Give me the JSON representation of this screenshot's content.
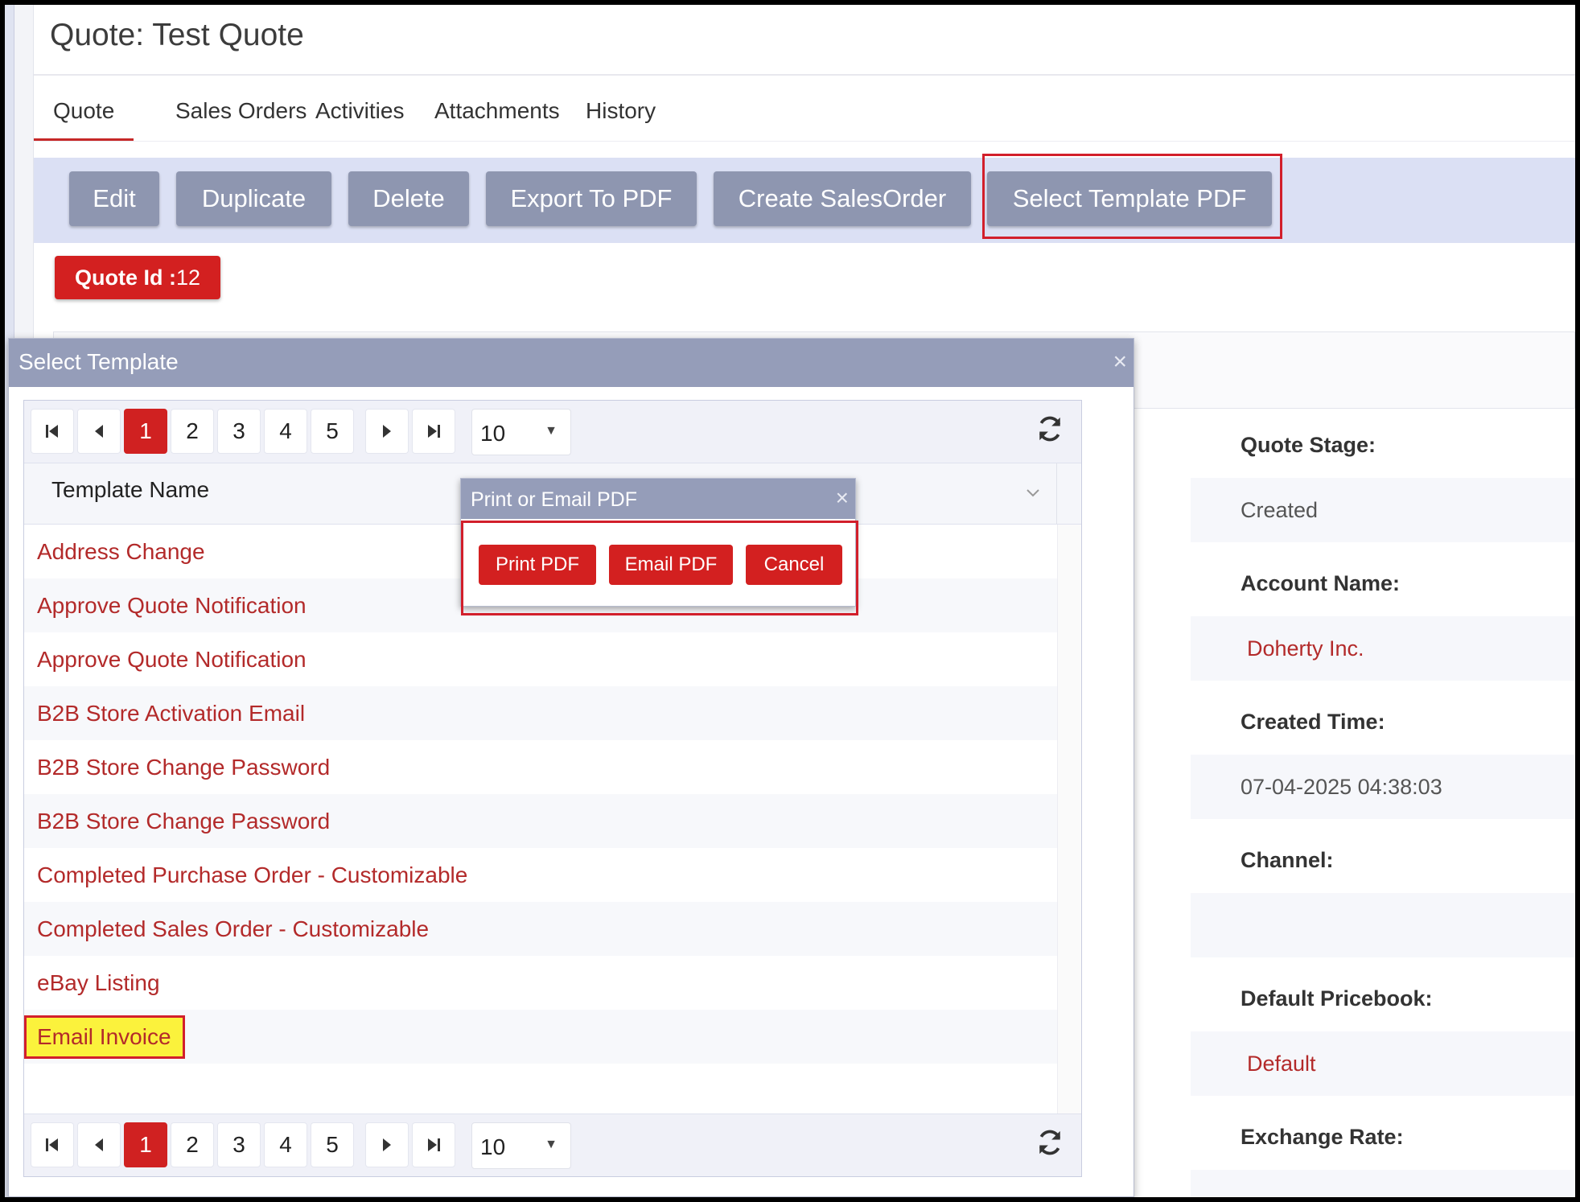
{
  "page": {
    "title": "Quote: Test Quote"
  },
  "tabs": [
    {
      "label": "Quote",
      "active": true
    },
    {
      "label": "Sales Orders"
    },
    {
      "label": "Activities"
    },
    {
      "label": "Attachments"
    },
    {
      "label": "History"
    }
  ],
  "toolbar": {
    "edit": "Edit",
    "duplicate": "Duplicate",
    "delete": "Delete",
    "export_pdf": "Export To PDF",
    "create_salesorder": "Create SalesOrder",
    "select_template_pdf": "Select Template PDF"
  },
  "quote_id": {
    "label": "Quote Id :",
    "value": "12"
  },
  "details": {
    "quote_stage_label": "Quote Stage:",
    "quote_stage_value": "Created",
    "account_name_label": "Account Name:",
    "account_name_value": "Doherty Inc.",
    "created_time_label": "Created Time:",
    "created_time_value": "07-04-2025 04:38:03",
    "channel_label": "Channel:",
    "channel_value": "",
    "default_pricebook_label": "Default Pricebook:",
    "default_pricebook_value": "Default",
    "exchange_rate_label": "Exchange Rate:"
  },
  "select_template_dialog": {
    "title": "Select Template",
    "close": "×",
    "column_header": "Template Name",
    "pager": {
      "first_icon": "first-page-icon",
      "prev_icon": "prev-page-icon",
      "pages": [
        "1",
        "2",
        "3",
        "4",
        "5"
      ],
      "current_page": "1",
      "next_icon": "next-page-icon",
      "last_icon": "last-page-icon",
      "page_size": "10",
      "refresh_icon": "refresh-icon"
    },
    "templates": [
      "Address Change",
      "Approve Quote Notification",
      "Approve Quote Notification",
      "B2B Store Activation Email",
      "B2B Store Change Password",
      "B2B Store Change Password",
      "Completed Purchase Order - Customizable",
      "Completed Sales Order - Customizable",
      "eBay Listing",
      "Email Invoice"
    ],
    "selected_template": "Email Invoice"
  },
  "print_email_popup": {
    "title": "Print or Email PDF",
    "close": "×",
    "print_pdf": "Print PDF",
    "email_pdf": "Email PDF",
    "cancel": "Cancel"
  },
  "colors": {
    "accent_red": "#d32020",
    "toolbar_bg": "#dbe0f4",
    "button_gray": "#8e96b0",
    "dialog_header": "#959db9",
    "link_red": "#b32a2a",
    "highlight_yellow": "#fbf23c"
  }
}
